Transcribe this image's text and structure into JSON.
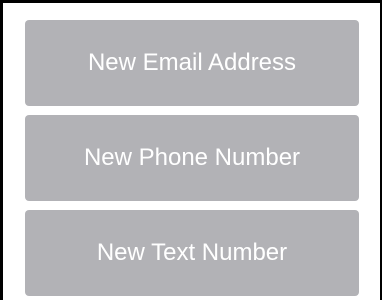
{
  "menu": {
    "buttons": [
      {
        "label": "New Email Address"
      },
      {
        "label": "New Phone Number"
      },
      {
        "label": "New Text Number"
      }
    ]
  },
  "colors": {
    "button_background": "#b2b2b6",
    "button_text": "#ffffff",
    "border": "#000000",
    "page_background": "#ffffff"
  }
}
